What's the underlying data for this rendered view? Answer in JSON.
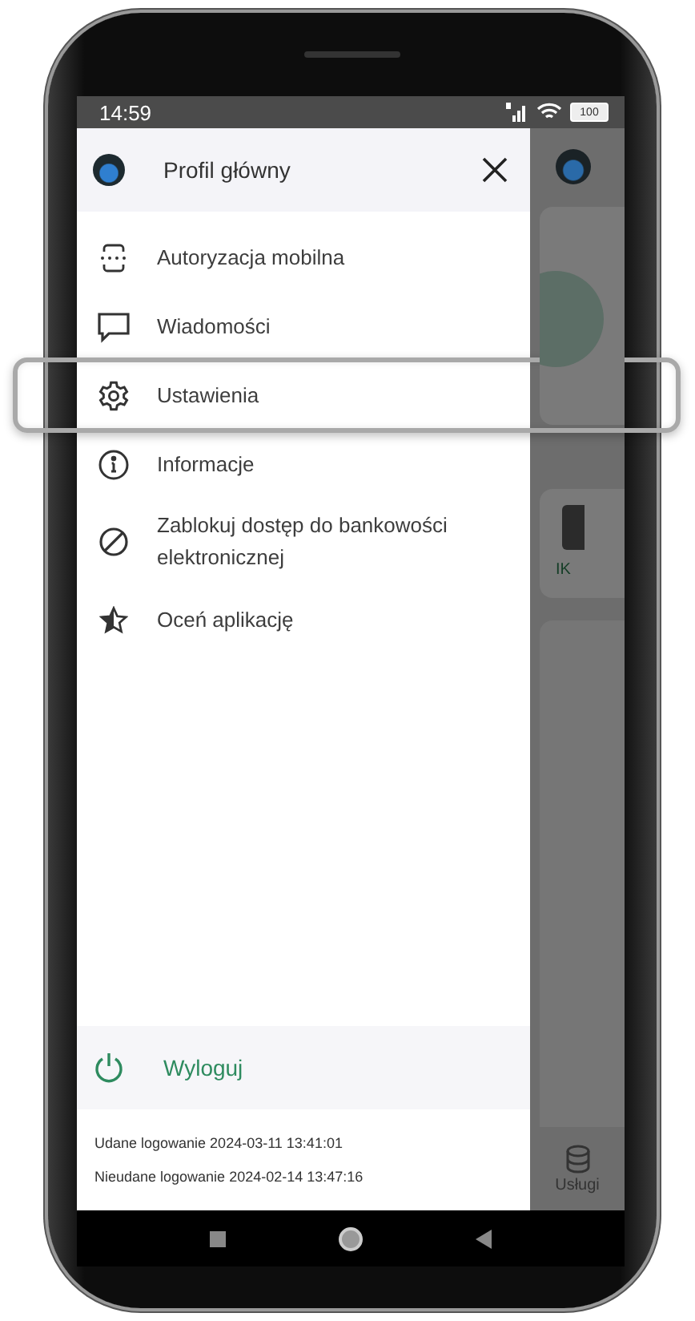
{
  "status_bar": {
    "time": "14:59",
    "battery": "100"
  },
  "drawer": {
    "profile_name": "Profil główny",
    "items": [
      {
        "label": "Autoryzacja mobilna",
        "kind": "auth",
        "highlighted": false
      },
      {
        "label": "Wiadomości",
        "kind": "messages",
        "highlighted": false
      },
      {
        "label": "Ustawienia",
        "kind": "settings",
        "highlighted": true
      },
      {
        "label": "Informacje",
        "kind": "info",
        "highlighted": false
      },
      {
        "label": "Zablokuj dostęp do bankowości elektronicznej",
        "kind": "block",
        "highlighted": false
      },
      {
        "label": "Oceń aplikację",
        "kind": "rate",
        "highlighted": false
      }
    ],
    "logout": "Wyloguj",
    "login_info": [
      "Udane logowanie 2024-03-11 13:41:01",
      "Nieudane logowanie 2024-02-14 13:47:16"
    ]
  },
  "background": {
    "tile_label": "IK",
    "nav_label": "Usługi"
  }
}
